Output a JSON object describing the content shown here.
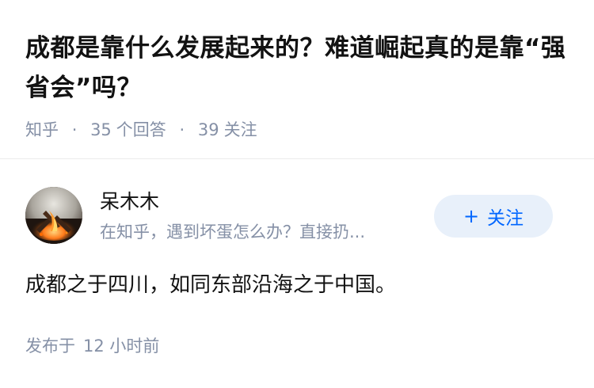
{
  "question": {
    "title": "成都是靠什么发展起来的？难道崛起真的是靠“强省会”吗？",
    "source": "知乎",
    "separator": "·",
    "answer_count": "35",
    "answer_label": "个回答",
    "follower_count": "39",
    "follower_label": "关注"
  },
  "answer": {
    "author": {
      "name": "呆木木",
      "bio": "在知乎，遇到坏蛋怎么办？直接扔..."
    },
    "follow_button": {
      "icon": "+",
      "label": "关注"
    },
    "content": "成都之于四川，如同东部沿海之于中国。",
    "publish_label": "发布于",
    "publish_time": "12 小时前"
  },
  "colors": {
    "primary_text": "#121212",
    "secondary_text": "#8590a6",
    "accent_blue": "#0066ff",
    "follow_bg": "#e8f0fa",
    "divider": "#ebebeb"
  },
  "icons": {
    "avatar": "campfire-avatar"
  }
}
